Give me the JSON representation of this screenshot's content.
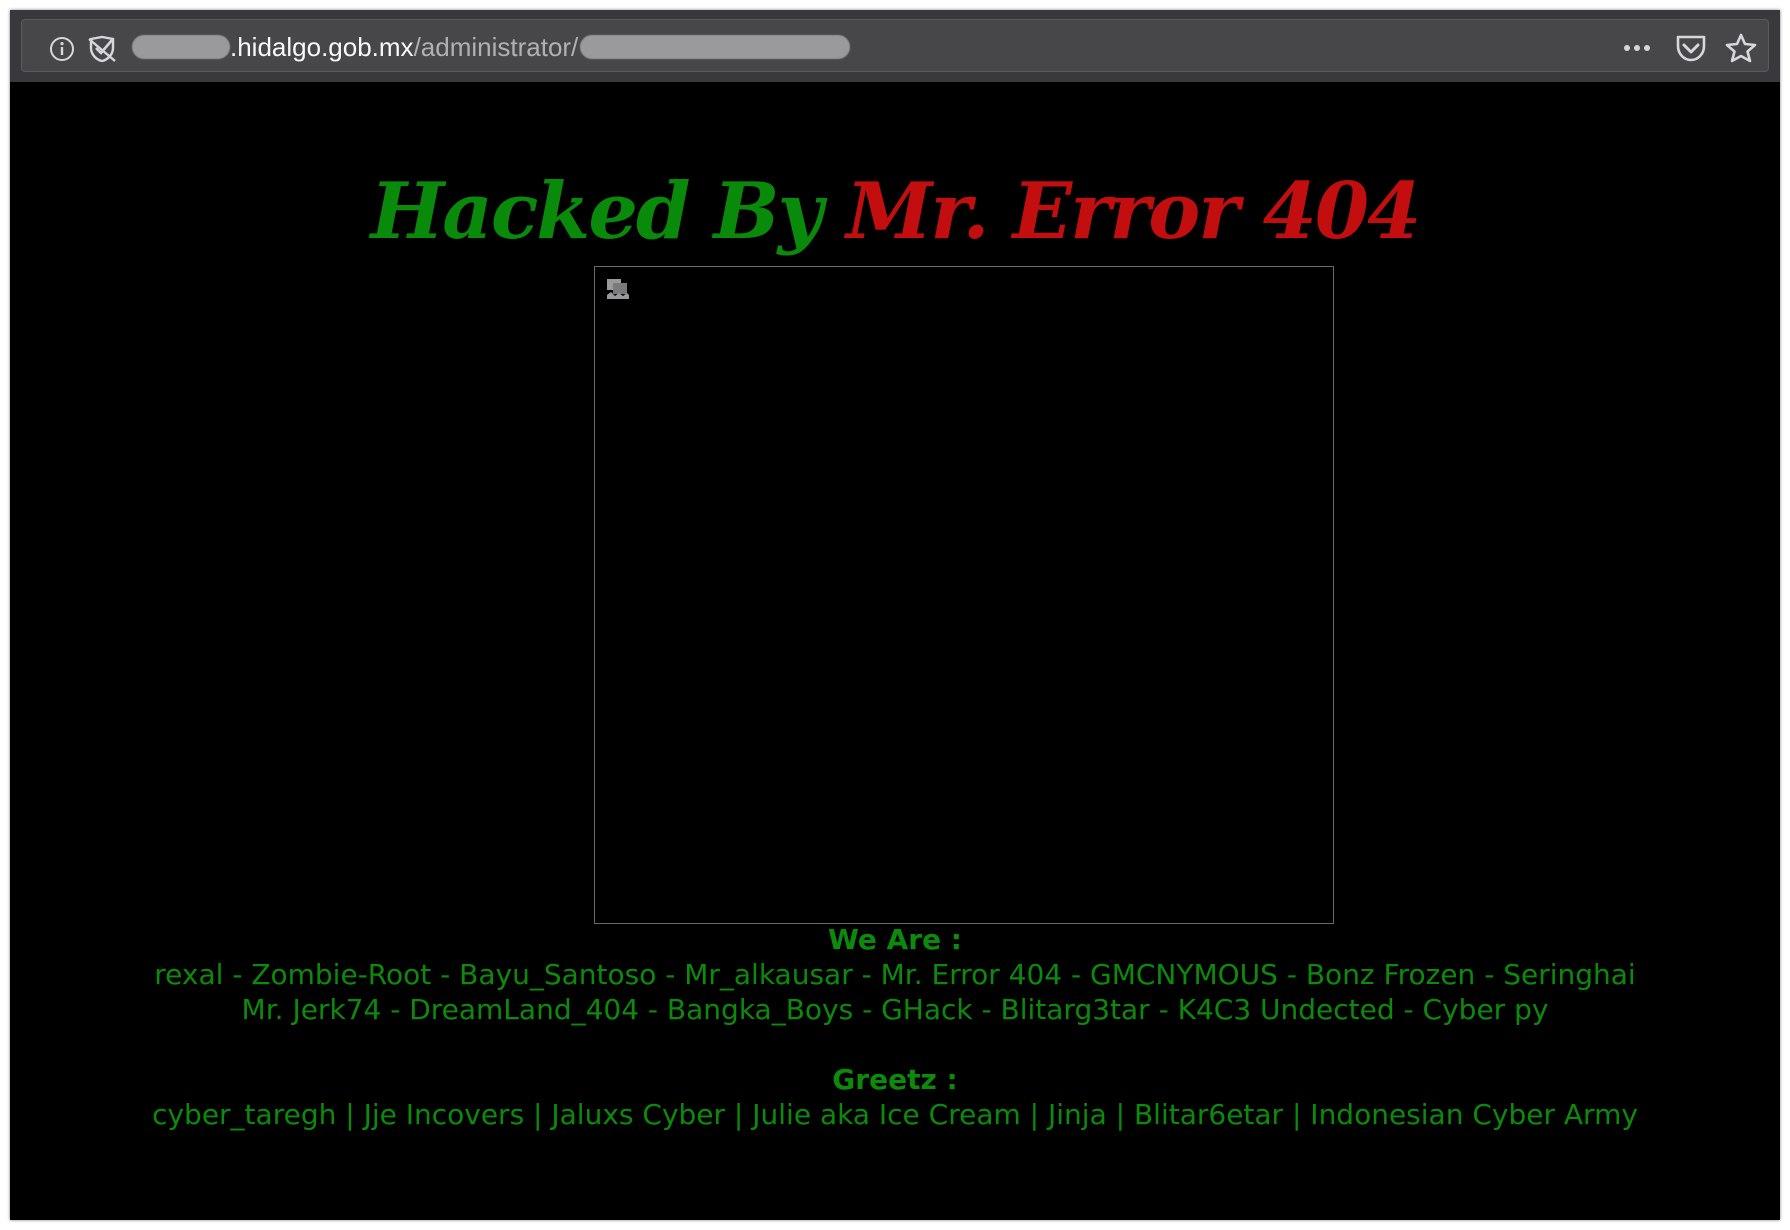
{
  "browser": {
    "url_host_visible": ".hidalgo.gob.mx",
    "url_path_visible": "/administrator/",
    "colors": {
      "toolbar": "#38383d",
      "urlbar": "#474749"
    }
  },
  "page": {
    "headline_part1": "Hacked By",
    "headline_part2": "Mr. Error 404",
    "we_are_label": "We Are :",
    "members_line1": "rexal - Zombie-Root - Bayu_Santoso - Mr_alkausar - Mr. Error 404 - GMCNYMOUS - Bonz Frozen - Seringhai",
    "members_line2": "Mr. Jerk74 - DreamLand_404 - Bangka_Boys - GHack - Blitarg3tar - K4C3 Undected - Cyber py",
    "greetz_label": "Greetz :",
    "greetz_list": "cyber_taregh | Jje Incovers | Jaluxs Cyber | Julie aka Ice Cream | Jinja | Blitar6etar | Indonesian Cyber Army",
    "colors": {
      "background": "#000000",
      "green": "#0a8a0a",
      "red": "#c20e0e"
    }
  },
  "icons": [
    "info-icon",
    "tracking-protection-icon",
    "more-actions-icon",
    "pocket-icon",
    "bookmark-star-icon",
    "broken-image-icon"
  ]
}
